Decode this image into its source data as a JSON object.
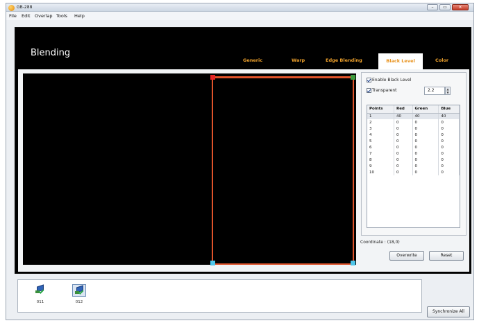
{
  "window": {
    "title": "GB-288"
  },
  "window_buttons": {
    "minimize": "–",
    "maximize": "▭",
    "close": "✕"
  },
  "menu": [
    "File",
    "Edit",
    "Overlap",
    "Tools",
    "Help"
  ],
  "page": {
    "heading": "Blending"
  },
  "tabs": [
    "Generic",
    "Warp",
    "Edge Blending",
    "Black Level",
    "Color"
  ],
  "active_tab": "Black Level",
  "colors": {
    "accent_tab": "#f0a22c",
    "selection_border": "#e0532a",
    "handle_top_left": "#e52525",
    "handle_top_right": "#3d9b3d",
    "handle_bottom": "#4ec6ea"
  },
  "black_level": {
    "enable_label": "Enable Black Level",
    "enable_checked": true,
    "transparent_label": "Transparent",
    "transparent_checked": true,
    "transparent_value": "2.2",
    "table": {
      "headers": [
        "Points",
        "Red",
        "Green",
        "Blue"
      ],
      "rows": [
        [
          "1",
          "40",
          "40",
          "40"
        ],
        [
          "2",
          "0",
          "0",
          "0"
        ],
        [
          "3",
          "0",
          "0",
          "0"
        ],
        [
          "4",
          "0",
          "0",
          "0"
        ],
        [
          "5",
          "0",
          "0",
          "0"
        ],
        [
          "6",
          "0",
          "0",
          "0"
        ],
        [
          "7",
          "0",
          "0",
          "0"
        ],
        [
          "8",
          "0",
          "0",
          "0"
        ],
        [
          "9",
          "0",
          "0",
          "0"
        ],
        [
          "10",
          "0",
          "0",
          "0"
        ]
      ]
    },
    "coordinate_label": "Coordinate : (18,0)",
    "overwrite_button": "Overwrite",
    "reset_button": "Reset"
  },
  "projectors": [
    {
      "label": "011",
      "icon": "projector-icon",
      "selected": false
    },
    {
      "label": "012",
      "icon": "projector-icon",
      "selected": true
    }
  ],
  "synchronize_button": "Synchronize All"
}
